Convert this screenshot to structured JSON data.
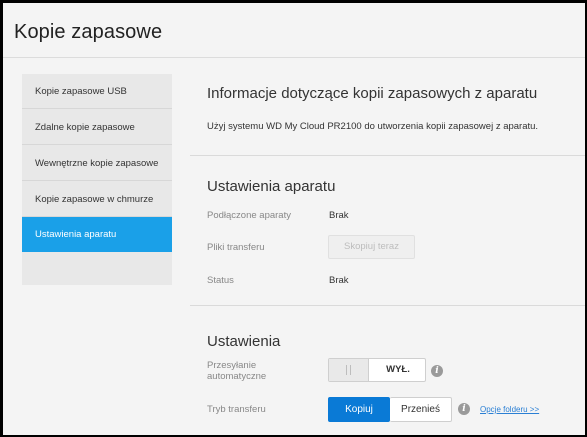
{
  "header": {
    "title": "Kopie zapasowe"
  },
  "sidebar": {
    "items": [
      {
        "label": "Kopie zapasowe USB"
      },
      {
        "label": "Zdalne kopie zapasowe"
      },
      {
        "label": "Wewnętrzne kopie zapasowe"
      },
      {
        "label": "Kopie zapasowe w chmurze"
      },
      {
        "label": "Ustawienia aparatu",
        "active": true
      }
    ]
  },
  "main": {
    "section_title": "Informacje dotyczące kopii zapasowych z aparatu",
    "description": "Użyj systemu WD My Cloud PR2100 do utworzenia kopii zapasowej z aparatu.",
    "camera_settings": {
      "title": "Ustawienia aparatu",
      "connected_label": "Podłączone aparaty",
      "connected_value": "Brak",
      "transfer_files_label": "Pliki transferu",
      "copy_now_button": "Skopiuj teraz",
      "status_label": "Status",
      "status_value": "Brak"
    },
    "settings": {
      "title": "Ustawienia",
      "auto_upload_label_line1": "Przesyłanie",
      "auto_upload_label_line2": "automatyczne",
      "auto_upload_value": "WYŁ.",
      "transfer_mode_label": "Tryb transferu",
      "transfer_mode_options": [
        "Kopiuj",
        "Przenieś"
      ],
      "transfer_mode_selected": "Kopiuj",
      "folder_options_link": "Opcje folderu >>"
    }
  },
  "colors": {
    "accent": "#1aa0e8",
    "button_active": "#0a7ad6",
    "link": "#2a7fd4"
  }
}
